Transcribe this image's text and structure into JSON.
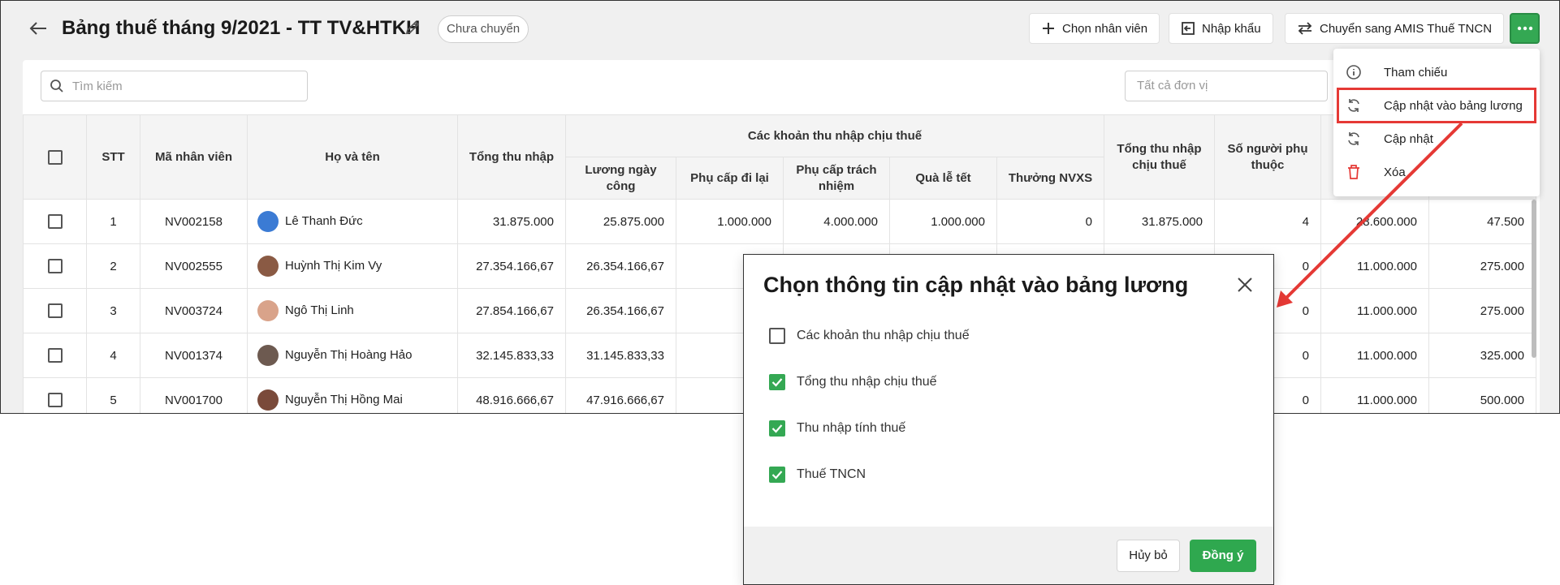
{
  "header": {
    "title": "Bảng thuế tháng 9/2021 - TT TV&HTKH",
    "status": "Chưa chuyển",
    "buttons": [
      "Chọn nhân viên",
      "Nhập khẩu",
      "Chuyển sang AMIS Thuế TNCN"
    ]
  },
  "toolbar": {
    "search_placeholder": "Tìm kiếm",
    "unit_placeholder": "Tất cả đơn vị"
  },
  "table": {
    "headers": {
      "stt": "STT",
      "ma_nv": "Mã nhân viên",
      "ho_ten": "Họ và tên",
      "tong_thu_nhap": "Tổng thu nhập",
      "group": "Các khoản thu nhập chịu thuế",
      "luong": "Lương ngày công",
      "phu_cap_di_lai": "Phụ cấp đi lại",
      "phu_cap_trach_nhiem": "Phụ cấp trách nhiệm",
      "qua_le_tet": "Quà lễ tết",
      "thuong": "Thưởng NVXS",
      "tong_thu_nhap_chiu_thue": "Tổng thu nhập chịu thuế",
      "so_nguoi_phu_thuoc": "Số người phụ thuộc"
    },
    "rows": [
      {
        "stt": "1",
        "code": "NV002158",
        "name": "Lê Thanh Đức",
        "total": "31.875.000",
        "luong": "25.875.000",
        "dilai": "1.000.000",
        "trachnhiem": "4.000.000",
        "tet": "1.000.000",
        "thuong": "0",
        "chiuthue": "31.875.000",
        "phuthuoc": "4",
        "c13": "28.600.000",
        "c14": "47.500"
      },
      {
        "stt": "2",
        "code": "NV002555",
        "name": "Huỳnh Thị Kim Vy",
        "total": "27.354.166,67",
        "luong": "26.354.166,67",
        "dilai": "",
        "trachnhiem": "",
        "tet": "",
        "thuong": "",
        "chiuthue": "",
        "phuthuoc": "0",
        "c13": "11.000.000",
        "c14": "275.000"
      },
      {
        "stt": "3",
        "code": "NV003724",
        "name": "Ngô Thị Linh",
        "total": "27.854.166,67",
        "luong": "26.354.166,67",
        "dilai": "",
        "trachnhiem": "",
        "tet": "",
        "thuong": "",
        "chiuthue": "",
        "phuthuoc": "0",
        "c13": "11.000.000",
        "c14": "275.000"
      },
      {
        "stt": "4",
        "code": "NV001374",
        "name": "Nguyễn Thị Hoàng Hảo",
        "total": "32.145.833,33",
        "luong": "31.145.833,33",
        "dilai": "",
        "trachnhiem": "",
        "tet": "",
        "thuong": "",
        "chiuthue": "",
        "phuthuoc": "0",
        "c13": "11.000.000",
        "c14": "325.000"
      },
      {
        "stt": "5",
        "code": "NV001700",
        "name": "Nguyễn Thị Hồng Mai",
        "total": "48.916.666,67",
        "luong": "47.916.666,67",
        "dilai": "",
        "trachnhiem": "",
        "tet": "",
        "thuong": "",
        "chiuthue": "",
        "phuthuoc": "0",
        "c13": "11.000.000",
        "c14": "500.000"
      }
    ]
  },
  "menu": {
    "items": [
      "Tham chiếu",
      "Cập nhật vào bảng lương",
      "Cập nhật",
      "Xóa"
    ]
  },
  "dialog": {
    "title": "Chọn thông tin cập nhật vào bảng lương",
    "options": [
      {
        "label": "Các khoản thu nhập chịu thuế",
        "checked": false
      },
      {
        "label": "Tổng thu nhập chịu thuế",
        "checked": true
      },
      {
        "label": "Thu nhập tính thuế",
        "checked": true
      },
      {
        "label": "Thuế TNCN",
        "checked": true
      }
    ],
    "cancel": "Hủy bỏ",
    "ok": "Đồng ý"
  },
  "colors": {
    "accent": "#34a853",
    "highlight": "#e53935"
  }
}
